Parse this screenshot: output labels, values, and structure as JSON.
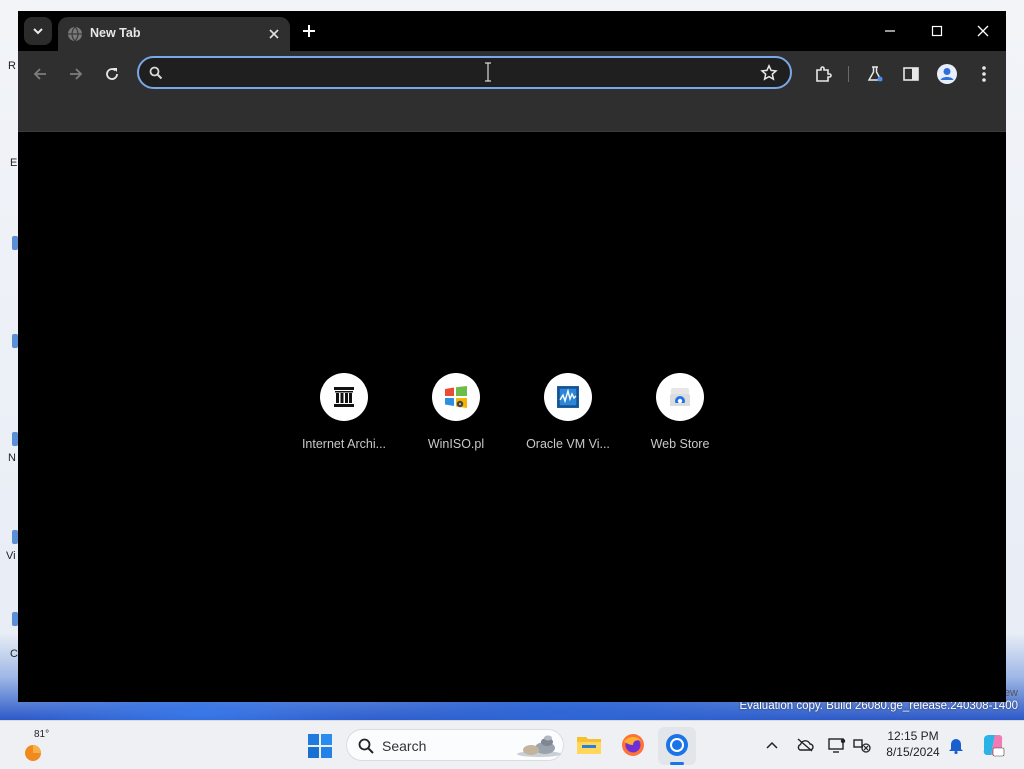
{
  "desktop": {
    "evaluation_text": "Evaluation copy. Build 26080.ge_release.240308-1400",
    "edge_text": "ew",
    "left_fragments": [
      "R",
      "E",
      "N",
      "Vi",
      "C"
    ]
  },
  "browser": {
    "tab": {
      "title": "New Tab",
      "favicon": "globe-icon"
    },
    "omnibox": {
      "value": "",
      "placeholder": ""
    },
    "shortcuts": [
      {
        "label": "Internet Archi...",
        "icon": "internet-archive-icon"
      },
      {
        "label": "WinISO.pl",
        "icon": "winiso-icon"
      },
      {
        "label": "Oracle VM Vi...",
        "icon": "virtualbox-icon"
      },
      {
        "label": "Web Store",
        "icon": "web-store-icon"
      }
    ]
  },
  "taskbar": {
    "weather_temp": "81°",
    "search_label": "Search",
    "time": "12:15 PM",
    "date": "8/15/2024"
  },
  "colors": {
    "omnibox_border": "#7aa7e8",
    "accent": "#1a73e8",
    "toolbar": "#2f2f2f"
  }
}
